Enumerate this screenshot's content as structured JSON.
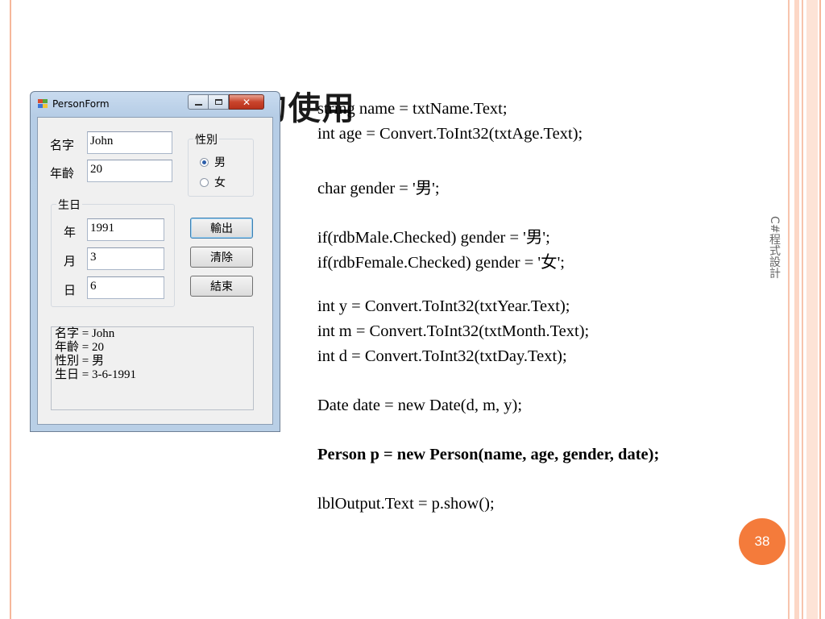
{
  "slide": {
    "title": "類別Person的使用",
    "side_text": "C#程式設計",
    "page_number": "38"
  },
  "code_lines": [
    "string name = txtName.Text;",
    "int age = Convert.ToInt32(txtAge.Text);",
    "char gender = '男';",
    "if(rdbMale.Checked) gender = '男';",
    "if(rdbFemale.Checked) gender = '女';",
    "int y = Convert.ToInt32(txtYear.Text);",
    "int m = Convert.ToInt32(txtMonth.Text);",
    "int d = Convert.ToInt32(txtDay.Text);",
    "Date date = new Date(d, m, y);",
    "Person p = new Person(name, age, gender, date);",
    "lblOutput.Text = p.show();"
  ],
  "form": {
    "title": "PersonForm",
    "name_label": "名字",
    "name_value": "John",
    "age_label": "年齡",
    "age_value": "20",
    "gender_group": "性別",
    "male_label": "男",
    "female_label": "女",
    "male_checked": true,
    "birthday_group": "生日",
    "year_label": "年",
    "year_value": "1991",
    "month_label": "月",
    "month_value": "3",
    "day_label": "日",
    "day_value": "6",
    "output_button": "輸出",
    "clear_button": "清除",
    "end_button": "結束",
    "output_lines": [
      "名字 = John",
      "年齡 = 20",
      "性別 = 男",
      "生日 = 3-6-1991"
    ]
  },
  "colors": {
    "accent": "#f47b3b",
    "stripe": "#f6b79a",
    "window_chrome": "#b9cfe6",
    "close_button": "#c9442c"
  }
}
